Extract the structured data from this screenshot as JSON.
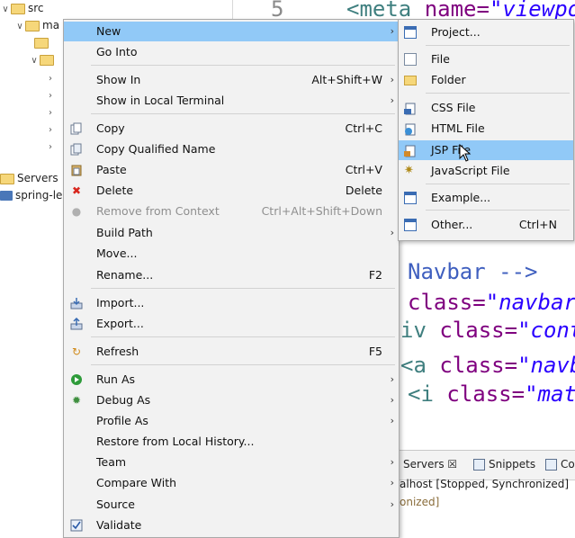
{
  "explorer": {
    "items": [
      {
        "label": "src"
      },
      {
        "label": "ma"
      },
      {
        "label": ""
      },
      {
        "label": ""
      },
      {
        "label": ""
      },
      {
        "label": ""
      },
      {
        "label": ""
      },
      {
        "label": ""
      },
      {
        "label": ""
      },
      {
        "label": "Servers"
      },
      {
        "label": "spring-le"
      }
    ]
  },
  "editor": {
    "line_number": "5",
    "top_code": {
      "tag": "<meta",
      "attr": "name=",
      "val": "\"viewpor"
    },
    "lines": [
      {
        "pre": "",
        "text_a": "Navbar -->",
        "text_b": "",
        "text_c": ""
      },
      {
        "pre": "",
        "text_a": "class=",
        "text_b": "\"navbar",
        "text_c": ""
      },
      {
        "pre": "iv ",
        "text_a": "class=",
        "text_b": "\"conta",
        "text_c": ""
      },
      {
        "pre": "<a ",
        "text_a": "class=",
        "text_b": "\"navba",
        "text_c": ""
      },
      {
        "pre": " <i ",
        "text_a": "class=",
        "text_b": "\"mat",
        "text_c": ""
      }
    ]
  },
  "views": {
    "tabs": [
      {
        "label": "Servers ☒"
      },
      {
        "label": "Snippets"
      },
      {
        "label": "Co"
      }
    ],
    "row1": "alhost  [Stopped, Synchronized]",
    "row2": "onized]"
  },
  "context_menu": {
    "items": [
      {
        "label": "New",
        "shortcut": "",
        "arrow": "›",
        "icon": "none",
        "highlight": true
      },
      {
        "label": "Go Into",
        "shortcut": "",
        "arrow": "",
        "icon": "none"
      },
      {
        "label": "Show In",
        "shortcut": "Alt+Shift+W",
        "arrow": "›",
        "icon": "none"
      },
      {
        "label": "Show in Local Terminal",
        "shortcut": "",
        "arrow": "›",
        "icon": "none"
      },
      {
        "label": "Copy",
        "shortcut": "Ctrl+C",
        "arrow": "",
        "icon": "copy-icon"
      },
      {
        "label": "Copy Qualified Name",
        "shortcut": "",
        "arrow": "",
        "icon": "copy-qualified-icon"
      },
      {
        "label": "Paste",
        "shortcut": "Ctrl+V",
        "arrow": "",
        "icon": "paste-icon"
      },
      {
        "label": "Delete",
        "shortcut": "Delete",
        "arrow": "",
        "icon": "delete-icon"
      },
      {
        "label": "Remove from Context",
        "shortcut": "Ctrl+Alt+Shift+Down",
        "arrow": "",
        "icon": "remove-context-icon",
        "disabled": true
      },
      {
        "label": "Build Path",
        "shortcut": "",
        "arrow": "›",
        "icon": "none"
      },
      {
        "label": "Move...",
        "shortcut": "",
        "arrow": "",
        "icon": "none"
      },
      {
        "label": "Rename...",
        "shortcut": "F2",
        "arrow": "",
        "icon": "none"
      },
      {
        "label": "Import...",
        "shortcut": "",
        "arrow": "",
        "icon": "import-icon"
      },
      {
        "label": "Export...",
        "shortcut": "",
        "arrow": "",
        "icon": "export-icon"
      },
      {
        "label": "Refresh",
        "shortcut": "F5",
        "arrow": "",
        "icon": "refresh-icon"
      },
      {
        "label": "Run As",
        "shortcut": "",
        "arrow": "›",
        "icon": "run-icon"
      },
      {
        "label": "Debug As",
        "shortcut": "",
        "arrow": "›",
        "icon": "debug-icon"
      },
      {
        "label": "Profile As",
        "shortcut": "",
        "arrow": "›",
        "icon": "none"
      },
      {
        "label": "Restore from Local History...",
        "shortcut": "",
        "arrow": "",
        "icon": "none"
      },
      {
        "label": "Team",
        "shortcut": "",
        "arrow": "›",
        "icon": "none"
      },
      {
        "label": "Compare With",
        "shortcut": "",
        "arrow": "›",
        "icon": "none"
      },
      {
        "label": "Source",
        "shortcut": "",
        "arrow": "›",
        "icon": "none"
      },
      {
        "label": "Validate",
        "shortcut": "",
        "arrow": "",
        "icon": "validate-checkbox-icon"
      }
    ]
  },
  "submenu": {
    "items": [
      {
        "label": "Project...",
        "shortcut": "",
        "icon": "project-icon"
      },
      {
        "label": "File",
        "shortcut": "",
        "icon": "file-icon"
      },
      {
        "label": "Folder",
        "shortcut": "",
        "icon": "folder-icon"
      },
      {
        "label": "CSS File",
        "shortcut": "",
        "icon": "css-file-icon"
      },
      {
        "label": "HTML File",
        "shortcut": "",
        "icon": "html-file-icon"
      },
      {
        "label": "JSP File",
        "shortcut": "",
        "icon": "jsp-file-icon",
        "highlight": true
      },
      {
        "label": "JavaScript File",
        "shortcut": "",
        "icon": "javascript-file-icon"
      },
      {
        "label": "Example...",
        "shortcut": "",
        "icon": "example-icon"
      },
      {
        "label": "Other...",
        "shortcut": "Ctrl+N",
        "icon": "other-wizard-icon"
      }
    ]
  },
  "colors": {
    "highlight": "#91c9f7",
    "menu_bg": "#f2f2f2",
    "code_tag": "#3f7f7f",
    "code_attr": "#7f007f",
    "code_value": "#2a00ff"
  }
}
